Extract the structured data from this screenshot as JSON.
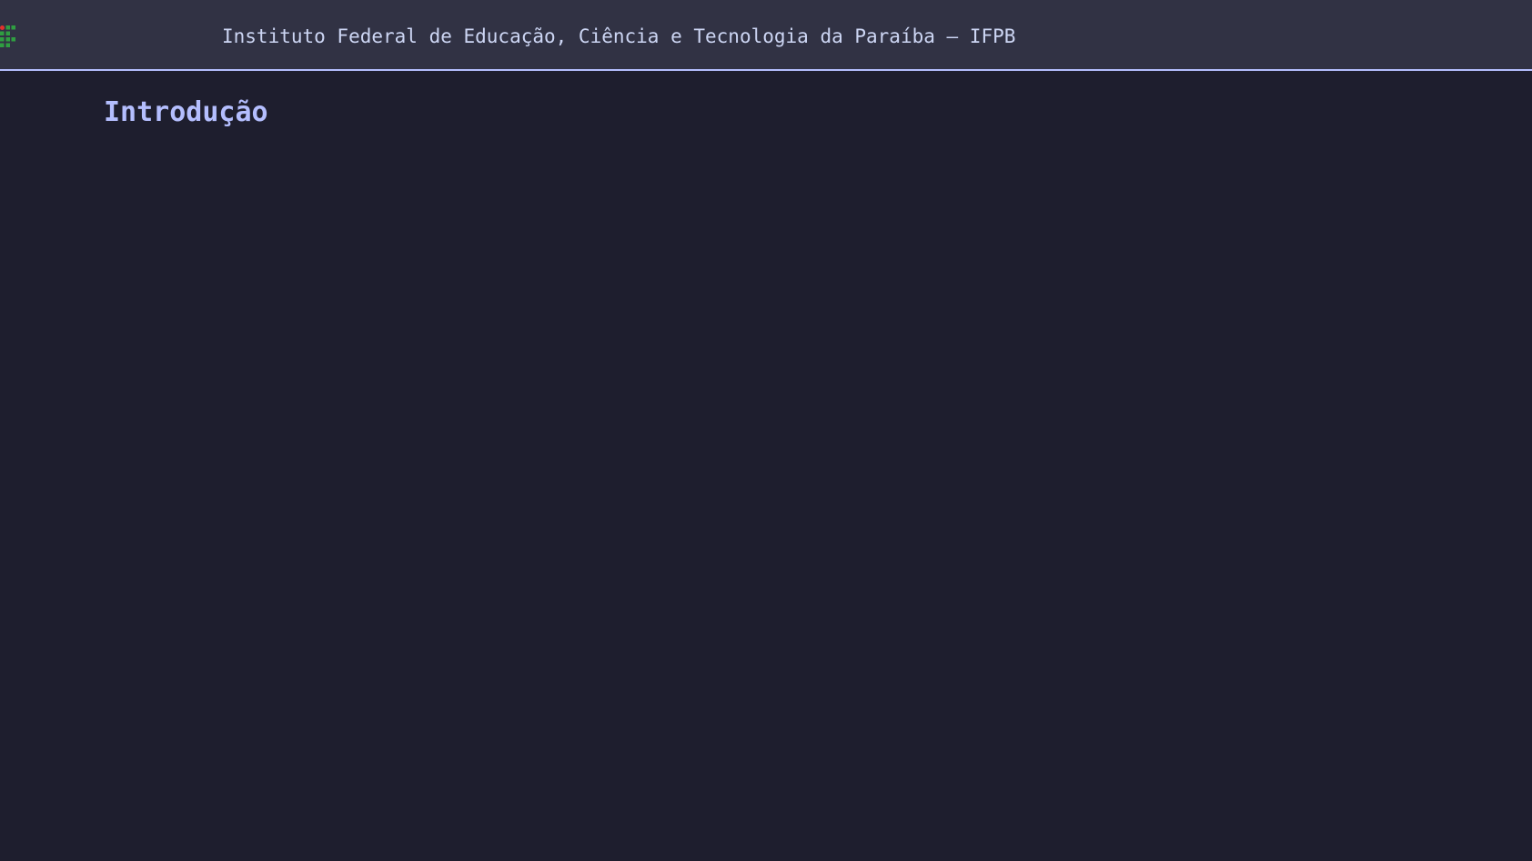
{
  "header": {
    "logo_icon": "ifpb-logo-icon",
    "title": "Instituto Federal de Educação, Ciência e Tecnologia da Paraíba – IFPB"
  },
  "slide": {
    "title": "Introdução"
  },
  "colors": {
    "background": "#1e1e2e",
    "header_background": "#313244",
    "header_border": "#b4befe",
    "header_text": "#cdd6f4",
    "slide_title": "#b4befe",
    "logo_red": "#e0322c",
    "logo_green": "#2f9e41"
  }
}
